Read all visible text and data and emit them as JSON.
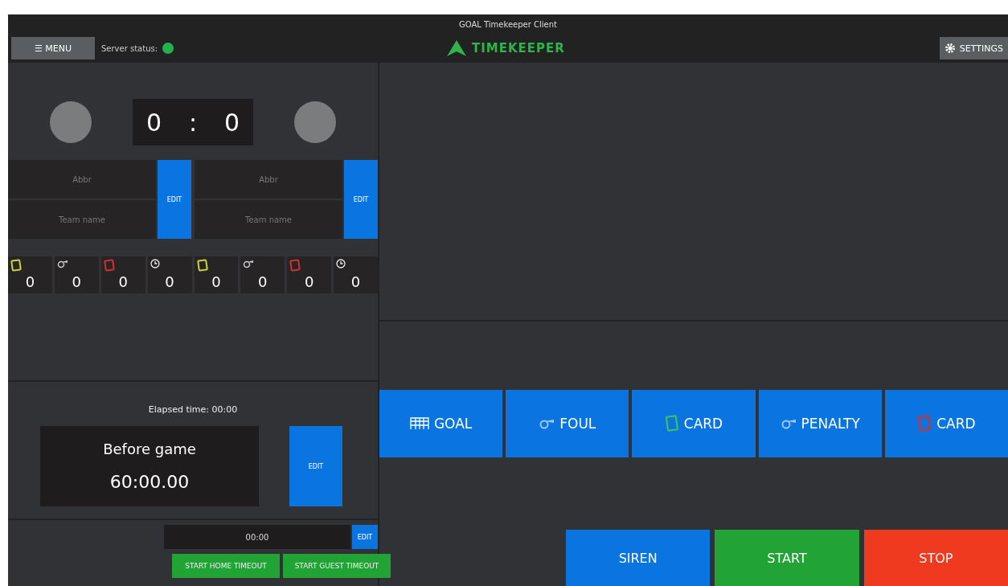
{
  "window": {
    "title": "GOAL Timekeeper Client"
  },
  "toolbar": {
    "menu": "MENU",
    "menu_icon": "☰",
    "server_status_label": "Server status:",
    "server_online": true,
    "logo": "TIMEKEEPER",
    "settings": "SETTINGS"
  },
  "score": {
    "home": "0",
    "separator": ":",
    "guest": "0"
  },
  "teams": [
    {
      "abbr_placeholder": "Abbr",
      "name_placeholder": "Team name",
      "edit": "EDIT"
    },
    {
      "abbr_placeholder": "Abbr",
      "name_placeholder": "Team name",
      "edit": "EDIT"
    }
  ],
  "stats": [
    {
      "kind": "yellow-card",
      "value": "0"
    },
    {
      "kind": "foul",
      "value": "0"
    },
    {
      "kind": "red-card",
      "value": "0"
    },
    {
      "kind": "timeout",
      "value": "0"
    },
    {
      "kind": "yellow-card",
      "value": "0"
    },
    {
      "kind": "foul",
      "value": "0"
    },
    {
      "kind": "red-card",
      "value": "0"
    },
    {
      "kind": "timeout",
      "value": "0"
    }
  ],
  "game_time": {
    "elapsed": "Elapsed time: 00:00",
    "phase": "Before game",
    "clock": "60:00.00",
    "edit": "EDIT"
  },
  "timeout": {
    "value": "00:00",
    "edit": "EDIT",
    "start_home": "START HOME TIMEOUT",
    "start_guest": "START GUEST TIMEOUT"
  },
  "events": [
    {
      "kind": "goal",
      "label": "GOAL"
    },
    {
      "kind": "foul",
      "label": "FOUL"
    },
    {
      "kind": "green-card",
      "label": "CARD"
    },
    {
      "kind": "penalty",
      "label": "PENALTY"
    },
    {
      "kind": "red-card",
      "label": "CARD"
    }
  ],
  "controls": [
    {
      "kind": "siren",
      "label": "SIREN"
    },
    {
      "kind": "start",
      "label": "START"
    },
    {
      "kind": "stop",
      "label": "STOP"
    }
  ]
}
